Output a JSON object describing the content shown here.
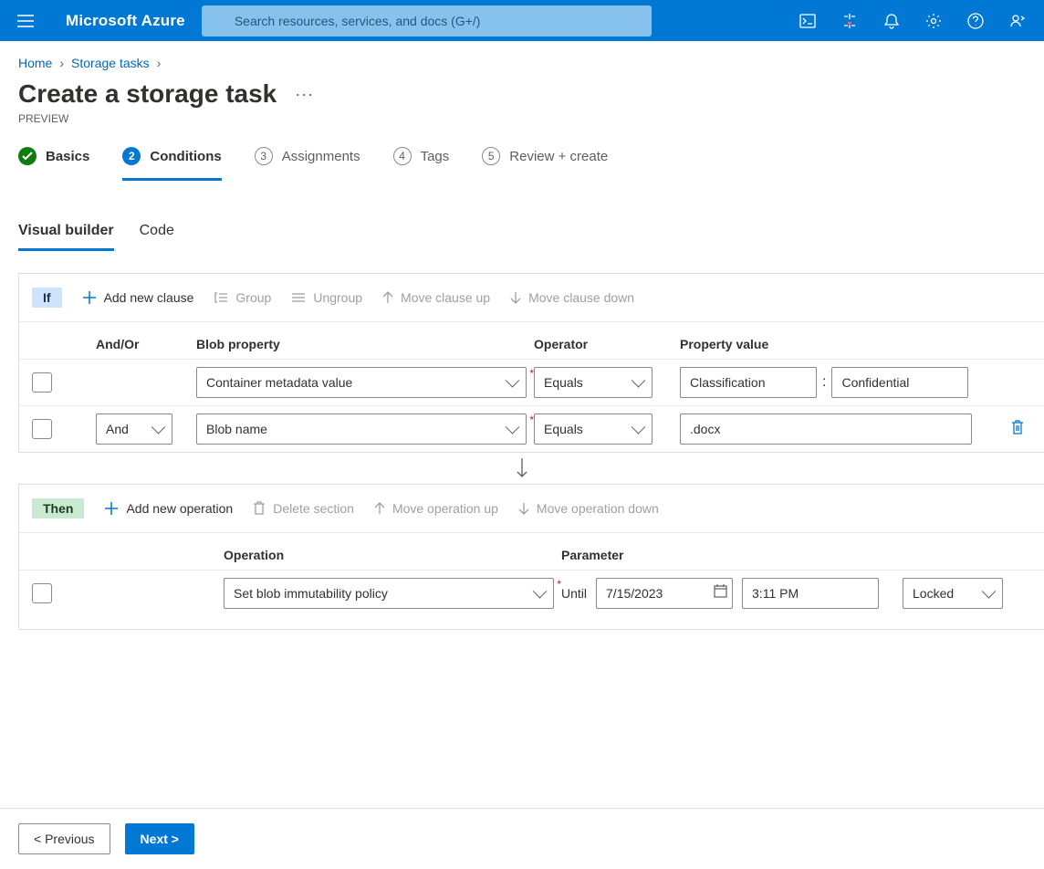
{
  "header": {
    "brand": "Microsoft Azure",
    "search_placeholder": "Search resources, services, and docs (G+/)"
  },
  "breadcrumbs": {
    "home": "Home",
    "storage_tasks": "Storage tasks"
  },
  "page": {
    "title": "Create a storage task",
    "subtitle": "PREVIEW"
  },
  "steps": {
    "basics": "Basics",
    "conditions_num": "2",
    "conditions": "Conditions",
    "assignments_num": "3",
    "assignments": "Assignments",
    "tags_num": "4",
    "tags": "Tags",
    "review_num": "5",
    "review": "Review + create"
  },
  "subtabs": {
    "visual": "Visual builder",
    "code": "Code"
  },
  "if_section": {
    "pill": "If",
    "add": "Add new clause",
    "group": "Group",
    "ungroup": "Ungroup",
    "move_up": "Move clause up",
    "move_down": "Move clause down",
    "headers": {
      "and_or": "And/Or",
      "blob_property": "Blob property",
      "operator": "Operator",
      "property_value": "Property value"
    },
    "rows": [
      {
        "and_or": "",
        "blob_property": "Container metadata value",
        "operator": "Equals",
        "pv_key": "Classification",
        "pv_val": "Confidential"
      },
      {
        "and_or": "And",
        "blob_property": "Blob name",
        "operator": "Equals",
        "pv": ".docx"
      }
    ]
  },
  "then_section": {
    "pill": "Then",
    "add": "Add new operation",
    "delete": "Delete section",
    "move_up": "Move operation up",
    "move_down": "Move operation down",
    "headers": {
      "operation": "Operation",
      "parameter": "Parameter"
    },
    "row": {
      "operation": "Set blob immutability policy",
      "until": "Until",
      "date": "7/15/2023",
      "time": "3:11 PM",
      "lock": "Locked"
    }
  },
  "footer": {
    "previous": "< Previous",
    "next": "Next >"
  }
}
